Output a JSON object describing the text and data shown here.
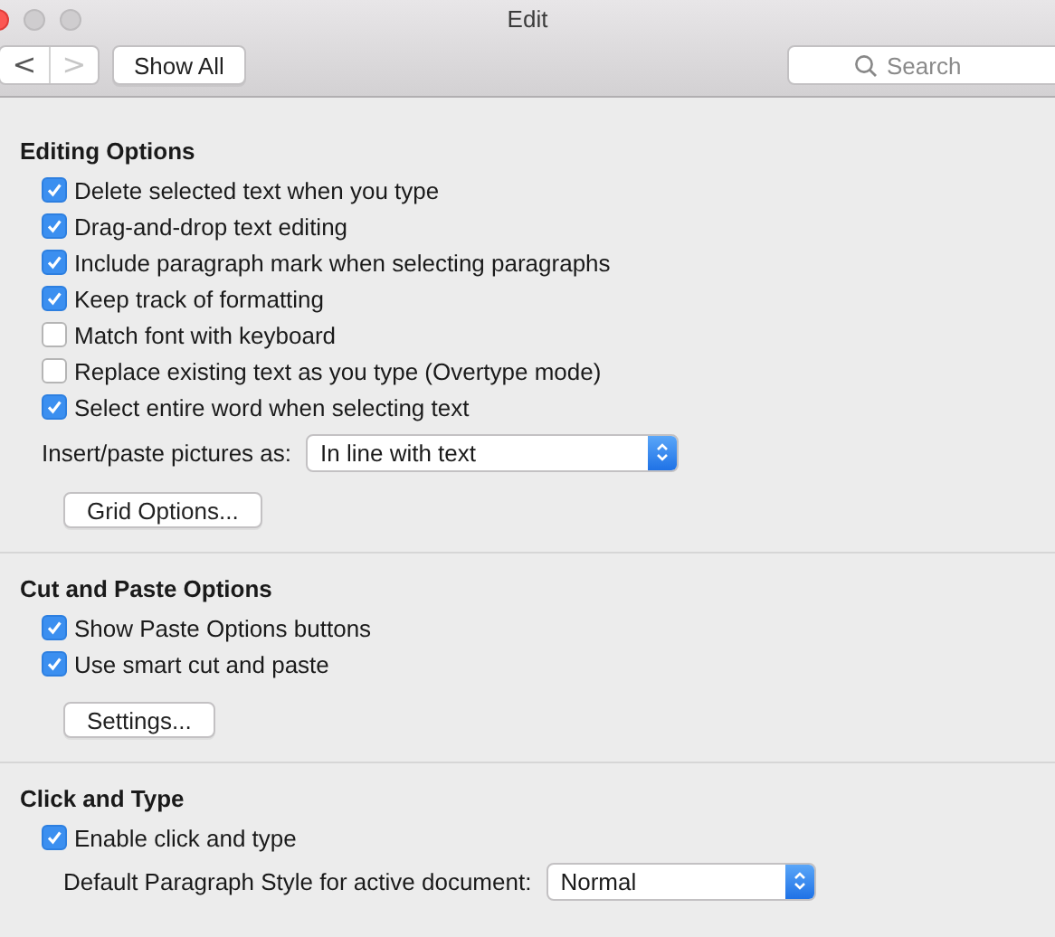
{
  "window": {
    "title": "Edit"
  },
  "toolbar": {
    "back": {
      "label": "<",
      "disabled": false
    },
    "forward": {
      "label": ">",
      "disabled": true
    },
    "show_all": "Show All",
    "search": {
      "placeholder": "Search"
    }
  },
  "sections": [
    {
      "title": "Editing Options",
      "items": [
        {
          "kind": "checkbox",
          "label": "Delete selected text when you type",
          "checked": true
        },
        {
          "kind": "checkbox",
          "label": "Drag-and-drop text editing",
          "checked": true
        },
        {
          "kind": "checkbox",
          "label": "Include paragraph mark when selecting paragraphs",
          "checked": true
        },
        {
          "kind": "checkbox",
          "label": "Keep track of formatting",
          "checked": true
        },
        {
          "kind": "checkbox",
          "label": "Match font with keyboard",
          "checked": false
        },
        {
          "kind": "checkbox",
          "label": "Replace existing text as you type (Overtype mode)",
          "checked": false
        },
        {
          "kind": "checkbox",
          "label": "Select entire word when selecting text",
          "checked": true
        },
        {
          "kind": "select",
          "label": "Insert/paste pictures as:",
          "value": "In line with text",
          "wide": true
        },
        {
          "kind": "button",
          "label": "Grid Options..."
        }
      ]
    },
    {
      "title": "Cut and Paste Options",
      "items": [
        {
          "kind": "checkbox",
          "label": "Show Paste Options buttons",
          "checked": true
        },
        {
          "kind": "checkbox",
          "label": "Use smart cut and paste",
          "checked": true
        },
        {
          "kind": "button",
          "label": "Settings..."
        }
      ]
    },
    {
      "title": "Click and Type",
      "items": [
        {
          "kind": "checkbox",
          "label": "Enable click and type",
          "checked": true
        },
        {
          "kind": "select",
          "label": "Default Paragraph Style for active document:",
          "value": "Normal",
          "wide": false
        }
      ]
    }
  ]
}
